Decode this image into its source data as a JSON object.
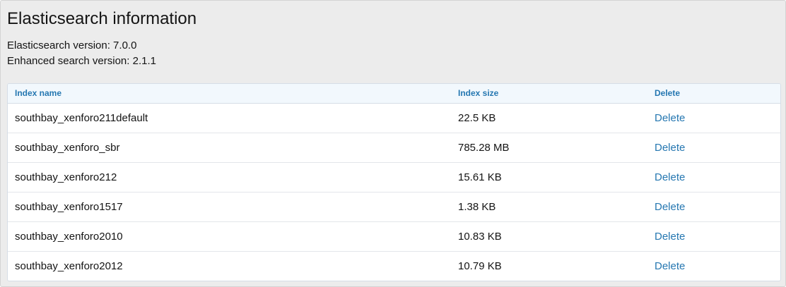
{
  "page": {
    "title": "Elasticsearch information",
    "es_version": "Elasticsearch version: 7.0.0",
    "enhanced_version": "Enhanced search version: 2.1.1"
  },
  "table": {
    "headers": {
      "name": "Index name",
      "size": "Index size",
      "delete": "Delete"
    },
    "rows": [
      {
        "name": "southbay_xenforo211default",
        "size": "22.5 KB",
        "action": "Delete"
      },
      {
        "name": "southbay_xenforo_sbr",
        "size": "785.28 MB",
        "action": "Delete"
      },
      {
        "name": "southbay_xenforo212",
        "size": "15.61 KB",
        "action": "Delete"
      },
      {
        "name": "southbay_xenforo1517",
        "size": "1.38 KB",
        "action": "Delete"
      },
      {
        "name": "southbay_xenforo2010",
        "size": "10.83 KB",
        "action": "Delete"
      },
      {
        "name": "southbay_xenforo2012",
        "size": "10.79 KB",
        "action": "Delete"
      }
    ]
  },
  "colors": {
    "link": "#2577b1",
    "header_bg": "#f2f8fd",
    "panel_bg": "#ececec"
  }
}
